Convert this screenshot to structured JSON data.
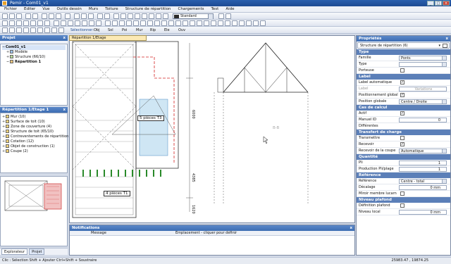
{
  "window": {
    "title": "Pemir - Com01_v1"
  },
  "menu": [
    "Fichier",
    "Editer",
    "Vue",
    "Outils dessin",
    "Murs",
    "Toiture",
    "Structure de répartition",
    "Chargements",
    "Test",
    "Aide"
  ],
  "toolbar": {
    "line_style": "Standard",
    "selection_label": "Sélectionner:",
    "selection_types": [
      "Obj",
      "Sol",
      "Poi",
      "Mur",
      "Rip",
      "Ele",
      "Ouv"
    ]
  },
  "project_panel": {
    "title": "Projet",
    "tree": [
      {
        "label": "Com01_v1",
        "level": 0,
        "selected": true
      },
      {
        "label": "Modèle",
        "level": 1
      },
      {
        "label": "Structure (66/10)",
        "level": 1
      },
      {
        "label": "Répartition 1",
        "level": 1,
        "bold": true
      }
    ]
  },
  "layer_panel": {
    "title": "Répartition 1/Etage 1",
    "tree": [
      "Mur (10)",
      "Surface de toit (10)",
      "Zone de couverture (4)",
      "Structure de toit (65/10)",
      "Contreventements de répartition (46)",
      "Cotation (12)",
      "Objet de construction (1)",
      "Coupe (2)"
    ]
  },
  "left_tabs": [
    "Explorateur",
    "Projet"
  ],
  "canvas": {
    "tab_label": "Répartition 1/Etage",
    "annotations": [
      "5 pièces T3",
      "4 pièces T1",
      "B-B"
    ],
    "dims": [
      "6000",
      "4385",
      "1620"
    ]
  },
  "notifications": {
    "title": "Notifications",
    "columns": [
      "Message",
      "Emplacement - cliquer pour définir"
    ]
  },
  "properties": {
    "title": "Propriétés",
    "object": "Structure de répartition (6)",
    "sections": [
      {
        "name": "Type",
        "rows": [
          {
            "label": "Famille",
            "type": "drop",
            "value": "Ponts"
          },
          {
            "label": "Type",
            "type": "drop",
            "value": ""
          },
          {
            "label": "Porteuse",
            "type": "check",
            "value": ""
          }
        ]
      },
      {
        "name": "Label",
        "rows": [
          {
            "label": "Label automatique",
            "type": "check",
            "value": "✓"
          },
          {
            "label": "Label",
            "type": "text",
            "value": "Variations",
            "disabled": true
          },
          {
            "label": "Positionnement global",
            "type": "check",
            "value": "✓"
          },
          {
            "label": "Position globale",
            "type": "drop",
            "value": "Centre / Droite"
          }
        ]
      },
      {
        "name": "Cas de calcul",
        "rows": [
          {
            "label": "Actif",
            "type": "check",
            "value": "✓"
          },
          {
            "label": "Manuel ID",
            "type": "num",
            "value": "0"
          },
          {
            "label": "Différentes",
            "type": "text",
            "value": ""
          }
        ]
      },
      {
        "name": "Transfert de charge",
        "rows": [
          {
            "label": "Transmettre",
            "type": "check",
            "value": ""
          },
          {
            "label": "Recevoir",
            "type": "check",
            "value": "✓"
          },
          {
            "label": "Recevoir de la coupe",
            "type": "drop",
            "value": "Automatique"
          }
        ]
      },
      {
        "name": "Quantité",
        "rows": [
          {
            "label": "Pli",
            "type": "num",
            "value": "1"
          },
          {
            "label": "Production Pli/plage",
            "type": "num",
            "value": "1"
          }
        ]
      },
      {
        "name": "Référence",
        "rows": [
          {
            "label": "Référence",
            "type": "drop",
            "value": "Centre - total"
          },
          {
            "label": "Décalage",
            "type": "num",
            "value": "0 mm"
          },
          {
            "label": "Miroir membre lucarn",
            "type": "check",
            "value": ""
          }
        ]
      },
      {
        "name": "Niveau plafond",
        "rows": [
          {
            "label": "Définition plafond",
            "type": "check",
            "value": ""
          },
          {
            "label": "Niveau local",
            "type": "num",
            "value": "0 mm"
          }
        ]
      }
    ]
  },
  "status": {
    "text": "Clic : Sélection  Shift + Ajouter  Ctrl+Shift + Soustraire",
    "coords": "25983.47 , 19874.25"
  }
}
